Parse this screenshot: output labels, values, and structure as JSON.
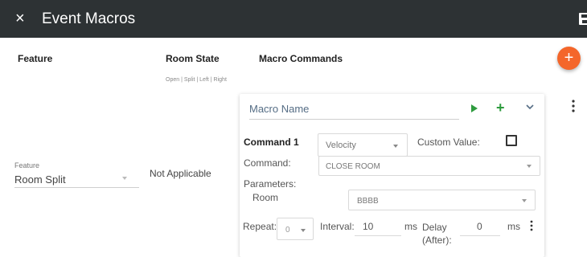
{
  "header": {
    "close_icon": "×",
    "title": "Event Macros",
    "save_icon": "save-icon"
  },
  "columns": {
    "feature": "Feature",
    "room_state": "Room State",
    "room_state_options": "Open | Split | Left | Right",
    "macro_commands": "Macro Commands"
  },
  "fab": {
    "label": "+"
  },
  "feature_field": {
    "label": "Feature",
    "value": "Room Split"
  },
  "room_state_value": "Not Applicable",
  "macro": {
    "name_placeholder": "Macro Name",
    "plus": "+",
    "command": {
      "title": "Command 1",
      "velocity_value": "Velocity",
      "custom_value_label": "Custom Value:",
      "custom_value_checked": false,
      "command_label": "Command:",
      "command_value": "CLOSE ROOM",
      "parameters_label": "Parameters:",
      "room_label": "Room",
      "room_value": "BBBB",
      "repeat_label": "Repeat:",
      "repeat_value": "0",
      "interval_label": "Interval:",
      "interval_value": "10",
      "interval_unit": "ms",
      "delay_label": "Delay (After):",
      "delay_value": "0",
      "delay_unit": "ms"
    }
  },
  "colors": {
    "header_bg": "#2d3234",
    "fab": "#f4662a",
    "action_green": "#2e9b3e",
    "macro_name_text": "#556d85"
  }
}
